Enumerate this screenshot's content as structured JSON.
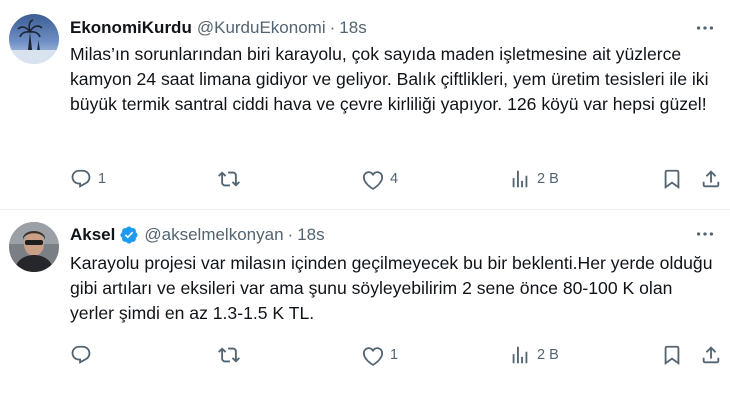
{
  "tweets": [
    {
      "display_name": "EkonomiKurdu",
      "handle": "@KurduEkonomi",
      "separator": "·",
      "time": "18s",
      "verified": false,
      "text": "Milas’ın sorunlarından biri karayolu, çok sayıda maden işletmesine ait yüzlerce kamyon 24 saat limana  gidiyor ve geliyor. Balık çiftlikleri, yem üretim tesisleri ile iki büyük termik santral ciddi hava ve çevre kirliliği yapıyor. 126 köyü var hepsi güzel!",
      "actions": {
        "reply": "1",
        "retweet": "",
        "like": "4",
        "views": "2 B"
      },
      "icons": {
        "more": "more-icon",
        "reply": "reply-icon",
        "retweet": "retweet-icon",
        "like": "heart-icon",
        "views": "views-icon",
        "bookmark": "bookmark-icon",
        "share": "share-icon"
      }
    },
    {
      "display_name": "Aksel",
      "handle": "@akselmelkonyan",
      "separator": "·",
      "time": "18s",
      "verified": true,
      "text": "Karayolu projesi var milasın içinden geçilmeyecek bu bir beklenti.Her yerde olduğu gibi artıları ve eksileri var ama şunu söyleyebilirim 2 sene önce 80-100 K olan yerler şimdi en az 1.3-1.5 K TL.",
      "actions": {
        "reply": "",
        "retweet": "",
        "like": "1",
        "views": "2 B"
      },
      "icons": {
        "more": "more-icon",
        "reply": "reply-icon",
        "retweet": "retweet-icon",
        "like": "heart-icon",
        "views": "views-icon",
        "bookmark": "bookmark-icon",
        "share": "share-icon"
      }
    }
  ],
  "colors": {
    "text": "#0f1419",
    "secondary": "#536471",
    "verified": "#1d9bf0",
    "divider": "#eff3f4"
  }
}
